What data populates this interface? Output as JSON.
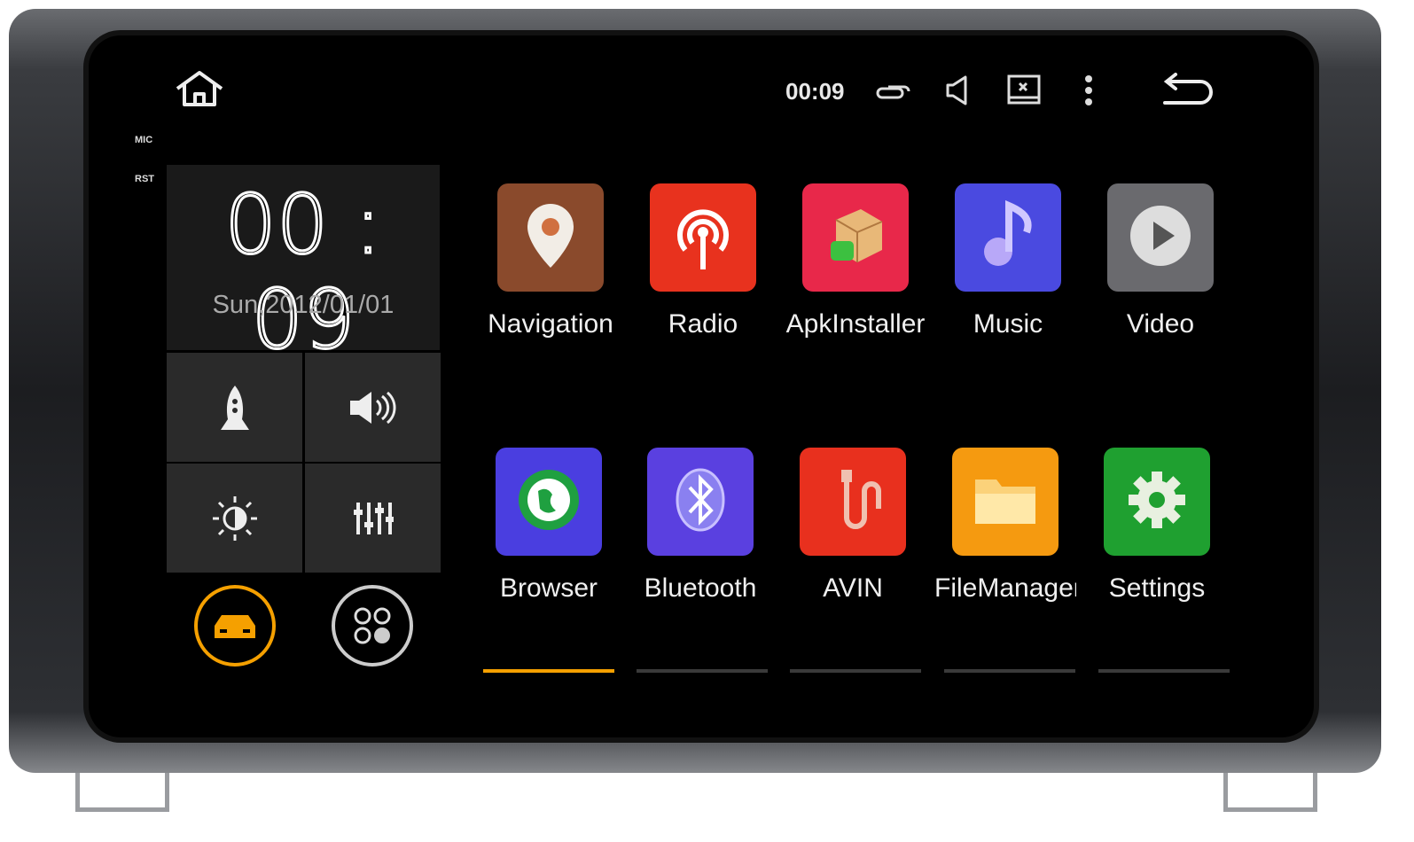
{
  "status_bar": {
    "time": "00:09",
    "icons": [
      "home-icon",
      "multitask-icon",
      "volume-icon",
      "screenshot-icon",
      "menu-icon",
      "back-icon"
    ]
  },
  "hardware_labels": {
    "mic": "MIC",
    "rst": "RST"
  },
  "clock_widget": {
    "time": "00 : 09",
    "date": "Sun,2012/01/01"
  },
  "quick_settings": [
    "rocket-icon",
    "speaker-icon",
    "brightness-icon",
    "equalizer-icon"
  ],
  "dock": [
    {
      "icon": "car-icon",
      "color": "#f5a000"
    },
    {
      "icon": "apps-grid-icon",
      "color": "#cccccc"
    }
  ],
  "apps": [
    {
      "label": "Navigation",
      "color": "#8a4a2c",
      "icon": "map-pin-icon"
    },
    {
      "label": "Radio",
      "color": "#e8321e",
      "icon": "radio-antenna-icon"
    },
    {
      "label": "ApkInstaller",
      "color": "#e8284a",
      "icon": "package-icon"
    },
    {
      "label": "Music",
      "color": "#4a4ae0",
      "icon": "music-note-icon"
    },
    {
      "label": "Video",
      "color": "#6a6a6e",
      "icon": "play-icon"
    },
    {
      "label": "Browser",
      "color": "#4a3ee0",
      "icon": "globe-icon"
    },
    {
      "label": "Bluetooth",
      "color": "#5a40e0",
      "icon": "bluetooth-icon"
    },
    {
      "label": "AVIN",
      "color": "#e8301e",
      "icon": "avin-plug-icon"
    },
    {
      "label": "FileManager",
      "color": "#f59a10",
      "icon": "folder-icon"
    },
    {
      "label": "Settings",
      "color": "#1fa030",
      "icon": "gear-icon"
    }
  ],
  "pager": {
    "pages": 5,
    "active": 1,
    "active_color": "#f5a000"
  }
}
